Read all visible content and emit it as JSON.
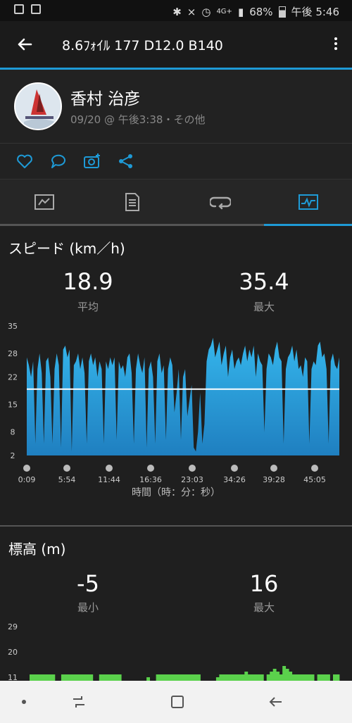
{
  "status_bar": {
    "battery": "68%",
    "time": "午後 5:46",
    "network": "4G+"
  },
  "app_bar": {
    "title": "8.6ﾌｫｲﾙ 177  D12.0 B140"
  },
  "profile": {
    "name": "香村 治彦",
    "meta": "09/20 @ 午後3:38・その他"
  },
  "speed_section": {
    "title": "スピード (km／h)",
    "avg_value": "18.9",
    "avg_label": "平均",
    "max_value": "35.4",
    "max_label": "最大",
    "xlabel": "時間（時：分：秒）"
  },
  "elevation_section": {
    "title": "標高 (m)",
    "min_value": "-5",
    "min_label": "最小",
    "max_value": "16",
    "max_label": "最大"
  },
  "colors": {
    "accent": "#1e9ad6",
    "speed_fill": "#2aa6dd",
    "elevation_fill": "#5bd14c"
  },
  "chart_data": [
    {
      "type": "area",
      "title": "スピード (km／h)",
      "xlabel": "時間（時：分：秒）",
      "ylabel": "",
      "ylim": [
        2,
        35
      ],
      "yticks": [
        2,
        8,
        15,
        22,
        28,
        35
      ],
      "xticks": [
        "0:09",
        "5:54",
        "11:44",
        "16:36",
        "23:03",
        "34:26",
        "39:28",
        "45:05"
      ],
      "average_line": 18.9,
      "series": [
        {
          "values": [
            27,
            25,
            22,
            26,
            5,
            24,
            28,
            23,
            5,
            26,
            27,
            22,
            5,
            24,
            28,
            25,
            4,
            29,
            30,
            27,
            29,
            3,
            25,
            26,
            28,
            24,
            27,
            23,
            5,
            26,
            28,
            25,
            27,
            22,
            26,
            24,
            5,
            26,
            24,
            27,
            25,
            27,
            6,
            26,
            24,
            25,
            22,
            27,
            28,
            23,
            5,
            24,
            28,
            25,
            23,
            27,
            4,
            24,
            26,
            22,
            5,
            26,
            28,
            23,
            25,
            6,
            24,
            27,
            25,
            13,
            18,
            24,
            6,
            22,
            24,
            12,
            16,
            20,
            4,
            3,
            8,
            18,
            5,
            10,
            26,
            29,
            30,
            32,
            27,
            29,
            31,
            25,
            28,
            30,
            22,
            27,
            29,
            24,
            26,
            27,
            25,
            28,
            30,
            26,
            29,
            27,
            30,
            22,
            28,
            26,
            25,
            8,
            24,
            28,
            27,
            25,
            29,
            31,
            27,
            26,
            5,
            24,
            27,
            28,
            30,
            26,
            29,
            24,
            25,
            22,
            27,
            26,
            5,
            24,
            26,
            25,
            30,
            31,
            27,
            28,
            24,
            5,
            26,
            28,
            25,
            24,
            27
          ]
        }
      ]
    },
    {
      "type": "area",
      "title": "標高 (m)",
      "ylim": [
        11,
        29
      ],
      "yticks": [
        11,
        20,
        29
      ],
      "series": [
        {
          "values": [
            12,
            12,
            12,
            12,
            12,
            12,
            12,
            12,
            0,
            0,
            12,
            12,
            12,
            12,
            12,
            12,
            12,
            12,
            12,
            12,
            0,
            0,
            12,
            12,
            12,
            12,
            12,
            12,
            12,
            0,
            0,
            0,
            0,
            0,
            0,
            0,
            0,
            11,
            0,
            0,
            12,
            12,
            12,
            12,
            12,
            12,
            12,
            12,
            12,
            12,
            12,
            12,
            12,
            12,
            0,
            0,
            0,
            0,
            0,
            11,
            12,
            12,
            12,
            12,
            12,
            12,
            12,
            12,
            13,
            12,
            12,
            12,
            12,
            12,
            0,
            12,
            13,
            14,
            13,
            12,
            15,
            14,
            13,
            12,
            12,
            12,
            12,
            12,
            12,
            12,
            0,
            12,
            12,
            12,
            12,
            0,
            12,
            12
          ]
        }
      ]
    }
  ]
}
